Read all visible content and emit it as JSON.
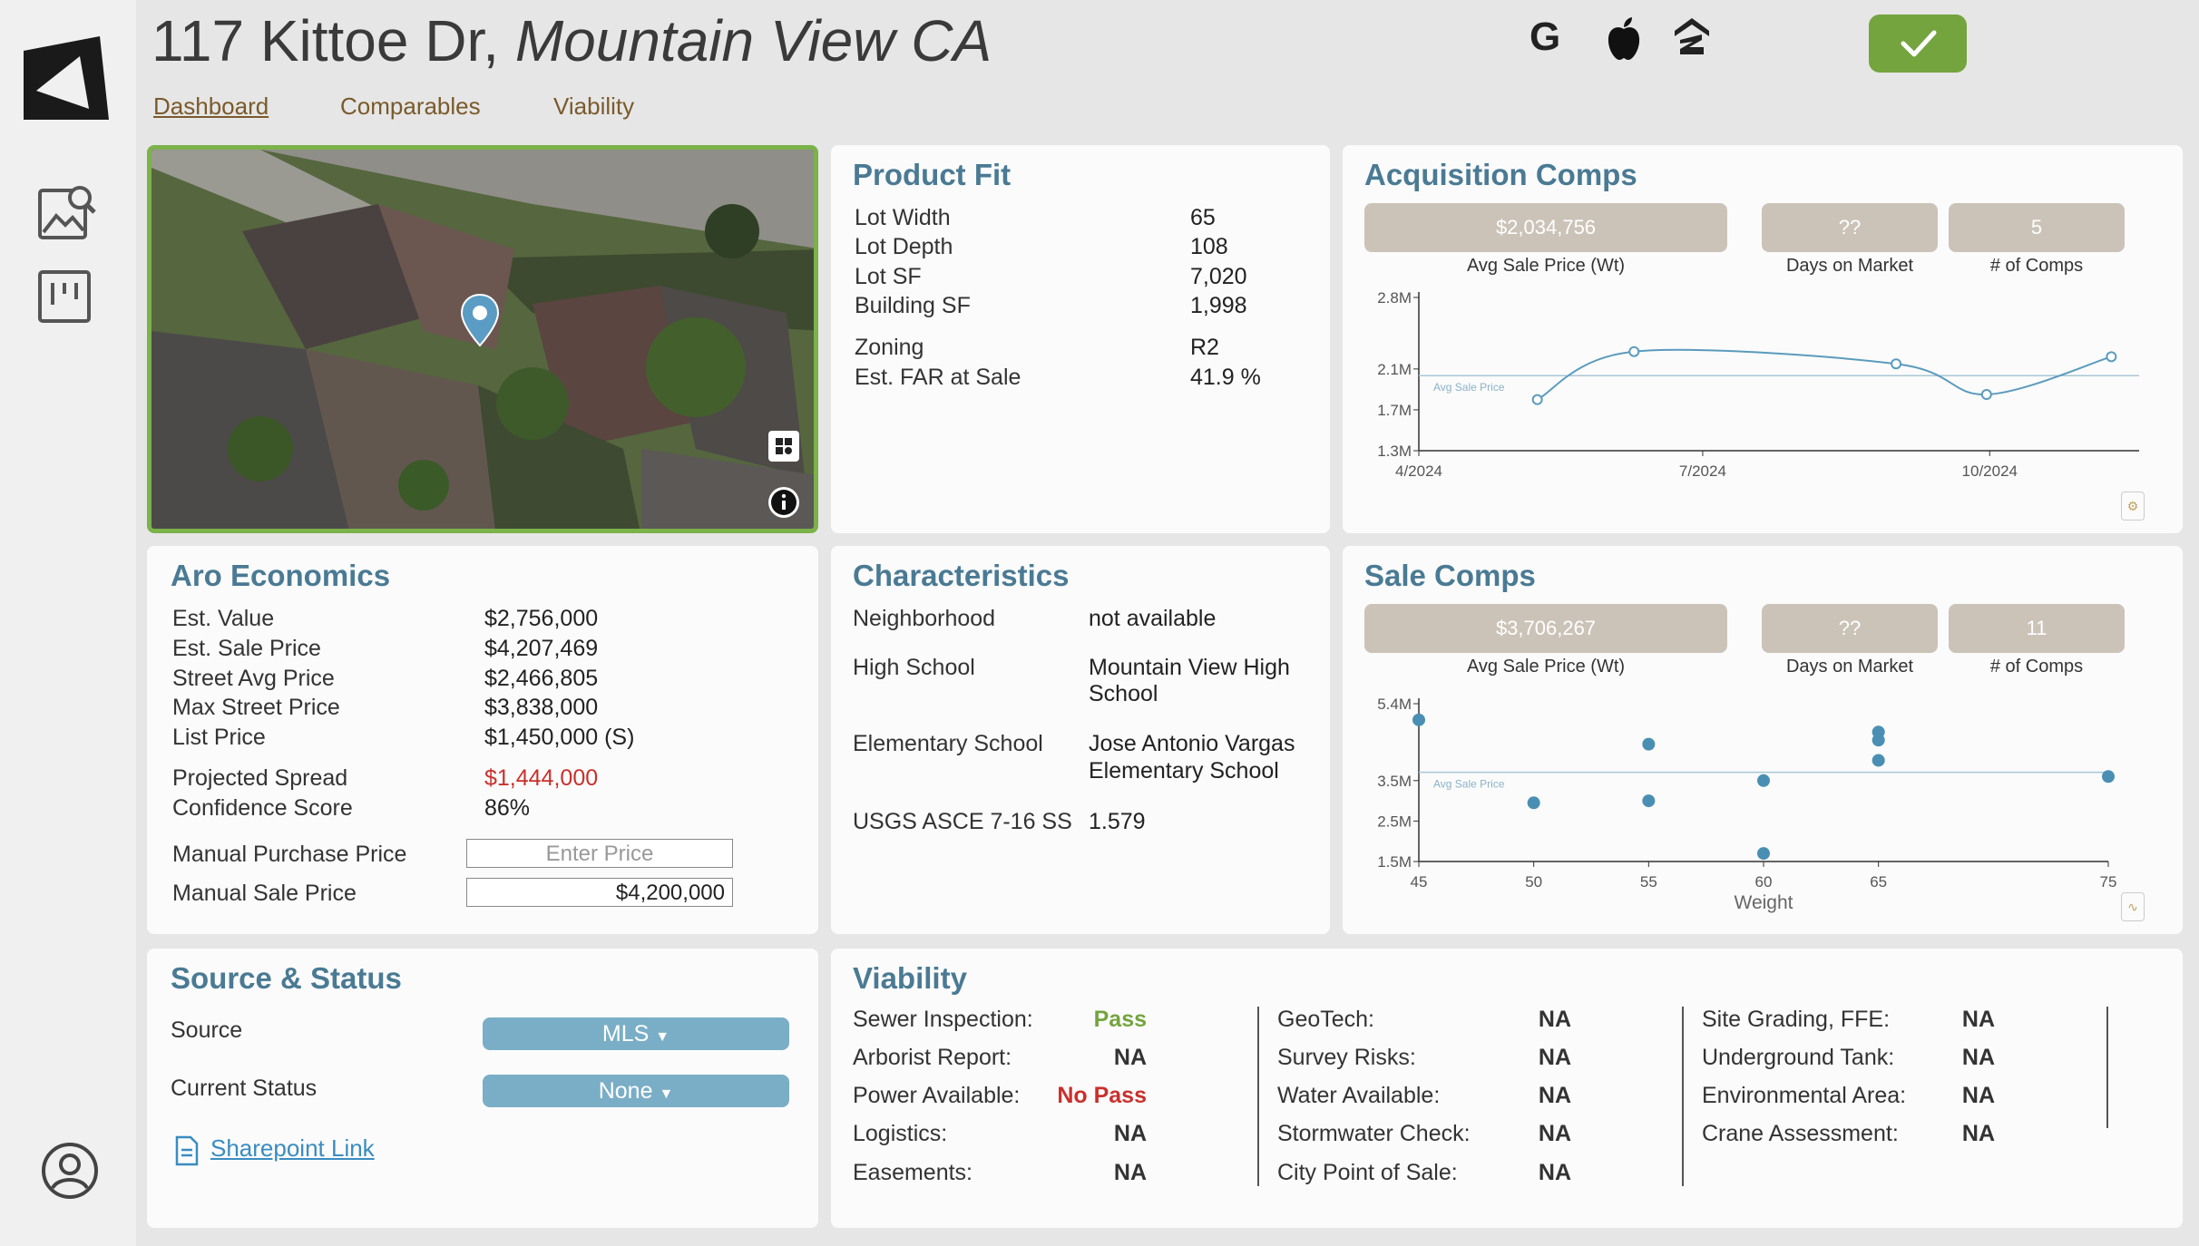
{
  "header": {
    "street": "117 Kittoe Dr,",
    "city": "Mountain View CA",
    "tabs": [
      "Dashboard",
      "Comparables",
      "Viability"
    ]
  },
  "icons": {
    "google": "G",
    "apple": "apple-icon",
    "zillow": "zillow-icon",
    "approve": "check-icon"
  },
  "colors": {
    "accent": "#4a7a94",
    "approve": "#74a43e",
    "kpi_bg": "#cbc3b8",
    "dropdown_bg": "#7aaec6",
    "negative": "#c9302c",
    "pass": "#74a43e"
  },
  "product_fit": {
    "title": "Product Fit",
    "rows": [
      {
        "label": "Lot Width",
        "value": "65"
      },
      {
        "label": "Lot Depth",
        "value": "108"
      },
      {
        "label": "Lot SF",
        "value": "7,020"
      },
      {
        "label": "Building SF",
        "value": "1,998"
      },
      {
        "label": "Zoning",
        "value": "R2"
      },
      {
        "label": "Est. FAR at Sale",
        "value": "41.9 %"
      }
    ]
  },
  "acquisition_comps": {
    "title": "Acquisition Comps",
    "kpis": [
      {
        "value": "$2,034,756",
        "label": "Avg Sale Price (Wt)"
      },
      {
        "value": "??",
        "label": "Days on Market"
      },
      {
        "value": "5",
        "label": "# of Comps"
      }
    ],
    "avg_line_label": "Avg Sale Price"
  },
  "aro_economics": {
    "title": "Aro Economics",
    "rows": [
      {
        "label": "Est. Value",
        "value": "$2,756,000"
      },
      {
        "label": "Est. Sale Price",
        "value": "$4,207,469"
      },
      {
        "label": "Street Avg Price",
        "value": "$2,466,805"
      },
      {
        "label": "Max Street Price",
        "value": "$3,838,000"
      },
      {
        "label": "List Price",
        "value": "$1,450,000 (S)"
      },
      {
        "label": "Projected Spread",
        "value": "$1,444,000"
      },
      {
        "label": "Confidence Score",
        "value": "86%"
      }
    ],
    "manual_purchase_label": "Manual Purchase Price",
    "manual_purchase_placeholder": "Enter Price",
    "manual_sale_label": "Manual Sale Price",
    "manual_sale_value": "$4,200,000"
  },
  "characteristics": {
    "title": "Characteristics",
    "neighborhood_label": "Neighborhood",
    "neighborhood_value": "not available",
    "high_school_label": "High School",
    "high_school_value_1": "Mountain View High",
    "high_school_value_2": "School",
    "elementary_label": "Elementary School",
    "elementary_value_1": "Jose Antonio Vargas",
    "elementary_value_2": "Elementary School",
    "usgs_label": "USGS ASCE 7-16 SS",
    "usgs_value": "1.579"
  },
  "sale_comps": {
    "title": "Sale Comps",
    "kpis": [
      {
        "value": "$3,706,267",
        "label": "Avg Sale Price (Wt)"
      },
      {
        "value": "??",
        "label": "Days on Market"
      },
      {
        "value": "11",
        "label": "# of Comps"
      }
    ],
    "avg_line_label": "Avg Sale Price"
  },
  "source_status": {
    "title": "Source & Status",
    "source_label": "Source",
    "source_value": "MLS",
    "status_label": "Current Status",
    "status_value": "None",
    "link_label": "Sharepoint Link"
  },
  "viability": {
    "title": "Viability",
    "col1": [
      {
        "label": "Sewer Inspection:",
        "value": "Pass",
        "status": "pass"
      },
      {
        "label": "Arborist Report:",
        "value": "NA",
        "status": "na"
      },
      {
        "label": "Power Available:",
        "value": "No Pass",
        "status": "fail"
      },
      {
        "label": "Logistics:",
        "value": "NA",
        "status": "na"
      },
      {
        "label": "Easements:",
        "value": "NA",
        "status": "na"
      }
    ],
    "col2": [
      {
        "label": "GeoTech:",
        "value": "NA",
        "status": "na"
      },
      {
        "label": "Survey Risks:",
        "value": "NA",
        "status": "na"
      },
      {
        "label": "Water Available:",
        "value": "NA",
        "status": "na"
      },
      {
        "label": "Stormwater Check:",
        "value": "NA",
        "status": "na"
      },
      {
        "label": "City Point of Sale:",
        "value": "NA",
        "status": "na"
      }
    ],
    "col3": [
      {
        "label": "Site Grading, FFE:",
        "value": "NA",
        "status": "na"
      },
      {
        "label": "Underground Tank:",
        "value": "NA",
        "status": "na"
      },
      {
        "label": "Environmental Area:",
        "value": "NA",
        "status": "na"
      },
      {
        "label": "Crane Assessment:",
        "value": "NA",
        "status": "na"
      }
    ]
  },
  "chart_data": [
    {
      "type": "line",
      "x": [
        "2024-05-09",
        "2024-06-09",
        "2024-09-01",
        "2024-09-30",
        "2024-11-09"
      ],
      "values": [
        1800000,
        2270000,
        2150000,
        1850000,
        2220000
      ],
      "avg_line": 2034756,
      "ylim": [
        1300000,
        2800000
      ],
      "xlim": [
        "2024-04-01",
        "2024-11-15"
      ],
      "ytick_labels": [
        "2.8M",
        "2.1M",
        "1.7M",
        "1.3M"
      ],
      "ytick_values": [
        2800000,
        2100000,
        1700000,
        1300000
      ],
      "xtick_labels": [
        "4/2024",
        "7/2024",
        "10/2024"
      ],
      "xtick_values": [
        "2024-04-01",
        "2024-07-01",
        "2024-10-01"
      ],
      "xlabel": "",
      "ylabel": "",
      "grid": false
    },
    {
      "type": "scatter",
      "x": [
        45,
        50,
        55,
        55,
        60,
        60,
        65,
        65,
        65,
        75
      ],
      "y": [
        5000000,
        2950000,
        4400000,
        3000000,
        3500000,
        1700000,
        4500000,
        4700000,
        4000000,
        3600000
      ],
      "avg_line": 3706267,
      "xlim": [
        45,
        75
      ],
      "ylim": [
        1500000,
        5400000
      ],
      "xticks": [
        45,
        50,
        55,
        60,
        65,
        75
      ],
      "ytick_labels": [
        "5.4M",
        "3.5M",
        "2.5M",
        "1.5M"
      ],
      "ytick_values": [
        5400000,
        3500000,
        2500000,
        1500000
      ],
      "xlabel": "Weight",
      "ylabel": "",
      "grid": false
    }
  ]
}
